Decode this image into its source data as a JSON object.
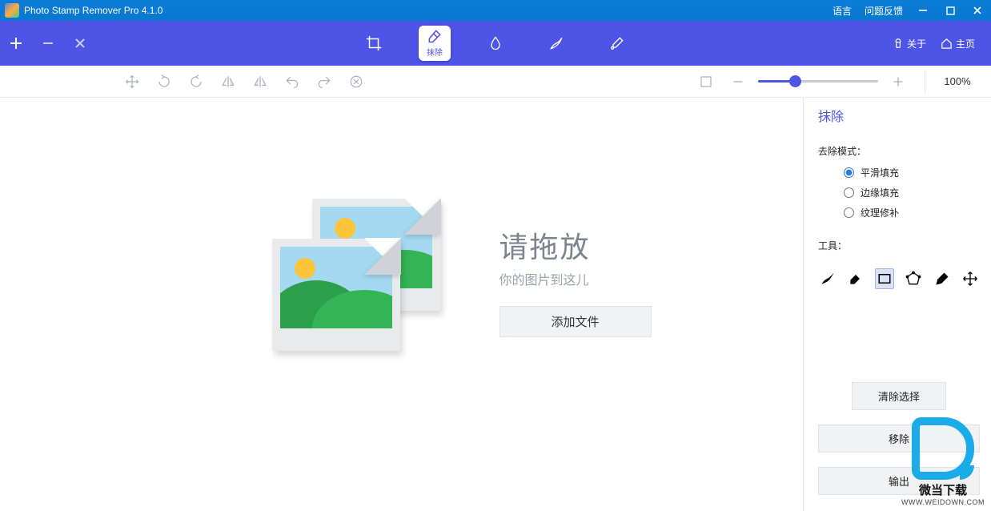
{
  "titlebar": {
    "title": "Photo Stamp Remover Pro 4.1.0",
    "language": "语言",
    "feedback": "问题反馈"
  },
  "toolbar": {
    "about": "关于",
    "home": "主页",
    "modes": {
      "erase": "抹除"
    }
  },
  "subbar": {
    "zoom_value": "100%"
  },
  "drop": {
    "title": "请拖放",
    "subtitle": "你的图片到这儿",
    "add_file": "添加文件"
  },
  "panel": {
    "title": "抹除",
    "mode_label": "去除模式：",
    "modes": {
      "smooth": "平滑填充",
      "edge": "边缘填充",
      "texture": "纹理修补"
    },
    "tools_label": "工具：",
    "clear_selection": "清除选择",
    "remove_btn": "移除",
    "output_btn": "输出"
  },
  "watermark": {
    "line1": "微当下载",
    "line2": "WWW.WEIDOWN.COM"
  }
}
